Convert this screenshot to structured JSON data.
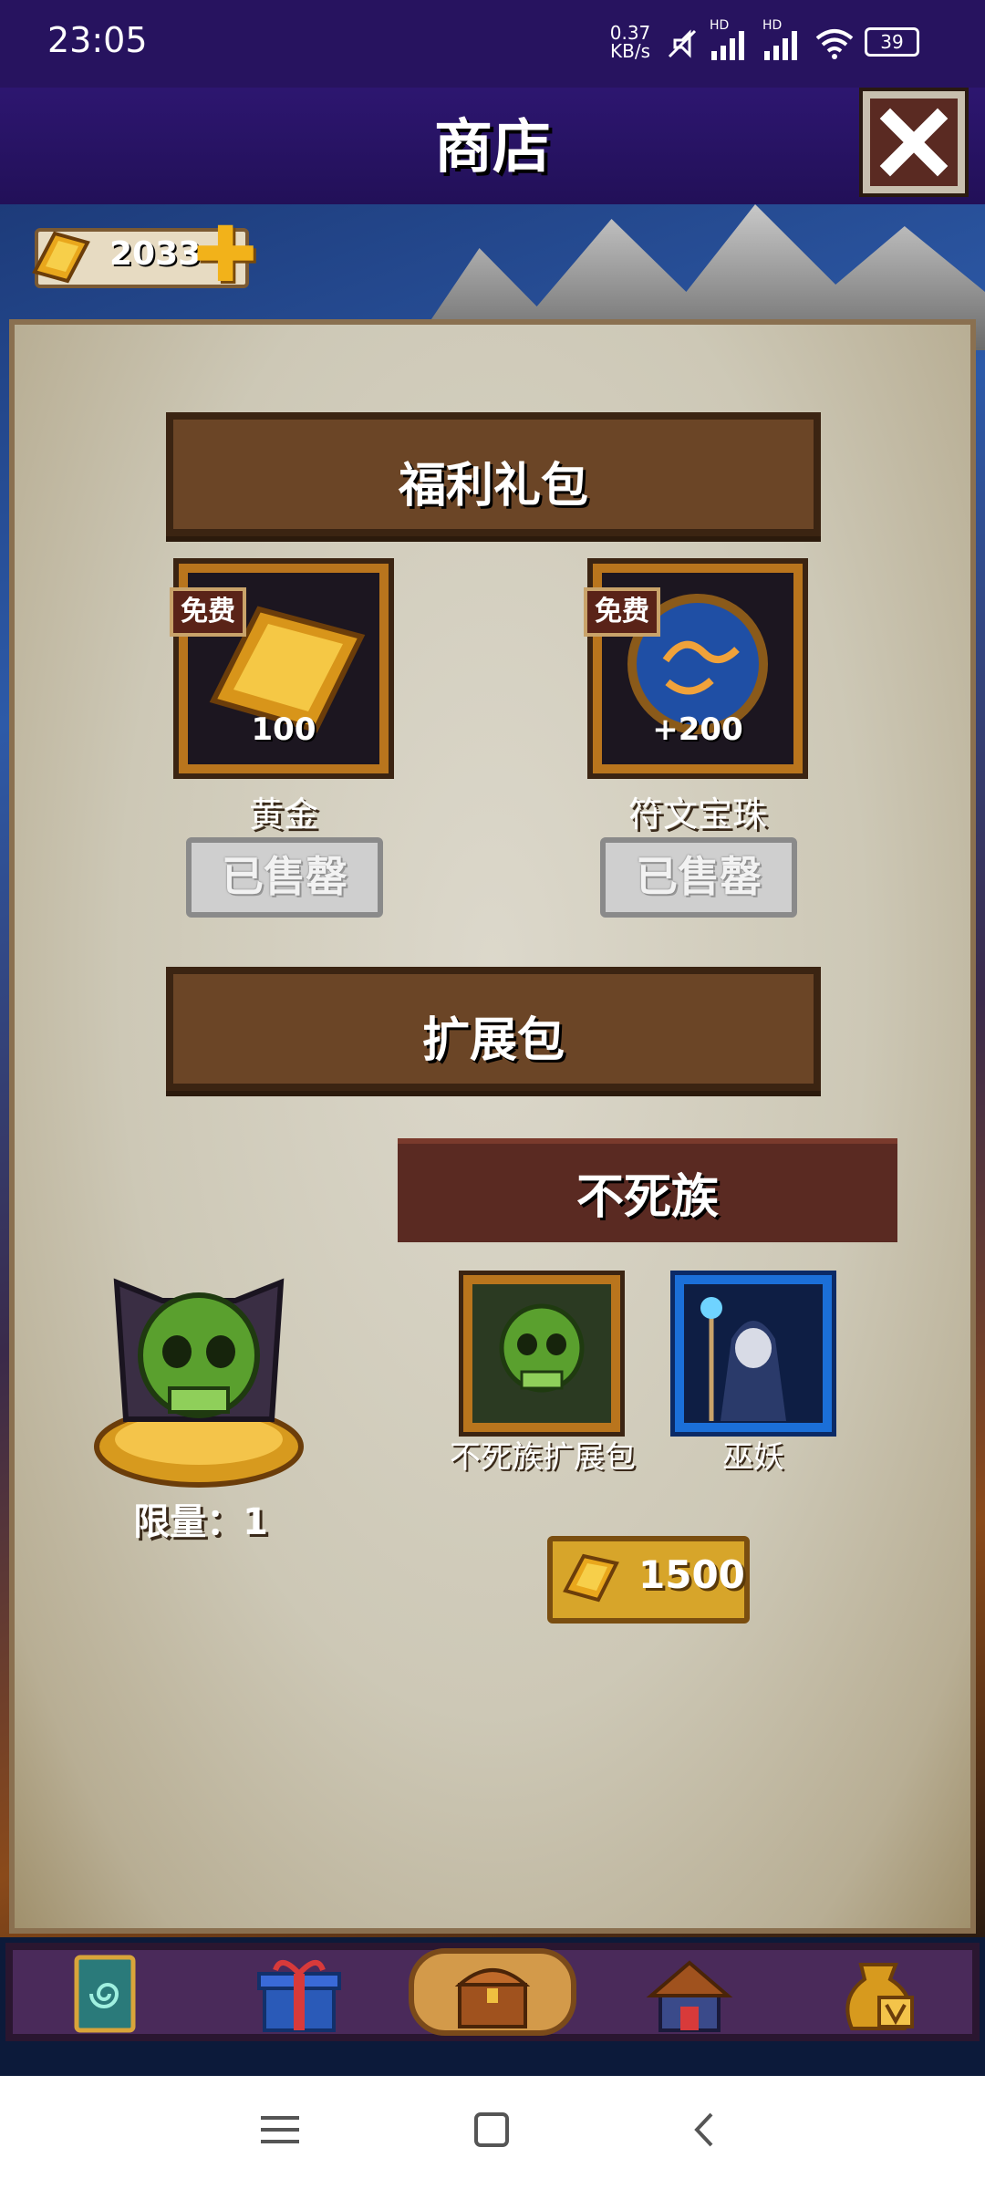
{
  "status_bar": {
    "time": "23:05",
    "net_speed_value": "0.37",
    "net_speed_unit": "KB/s",
    "signal1_label": "HD",
    "signal2_label": "HD",
    "battery": "39"
  },
  "header": {
    "title": "商店"
  },
  "currency": {
    "gold": "2033"
  },
  "welfare": {
    "title": "福利礼包",
    "items": [
      {
        "badge": "免费",
        "amount": "100",
        "name": "黄金",
        "button": "已售罄"
      },
      {
        "badge": "免费",
        "amount": "+200",
        "name": "符文宝珠",
        "button": "已售罄"
      }
    ]
  },
  "expansion": {
    "title": "扩展包",
    "faction": "不死族",
    "limit": "限量：1",
    "cards": [
      {
        "name": "不死族扩展包"
      },
      {
        "name": "巫妖"
      }
    ],
    "price": "1500"
  },
  "colors": {
    "header": "#27135f",
    "banner": "#6b4526",
    "tile_border": "#b9751d",
    "faction_tab": "#5a2a22",
    "price_button": "#d7a52a"
  },
  "icons": {
    "nav": [
      "card-deck-icon",
      "gift-icon",
      "treasure-chest-icon",
      "camp-icon",
      "gold-sack-icon"
    ],
    "system": [
      "menu-icon",
      "home-icon",
      "back-icon"
    ]
  }
}
